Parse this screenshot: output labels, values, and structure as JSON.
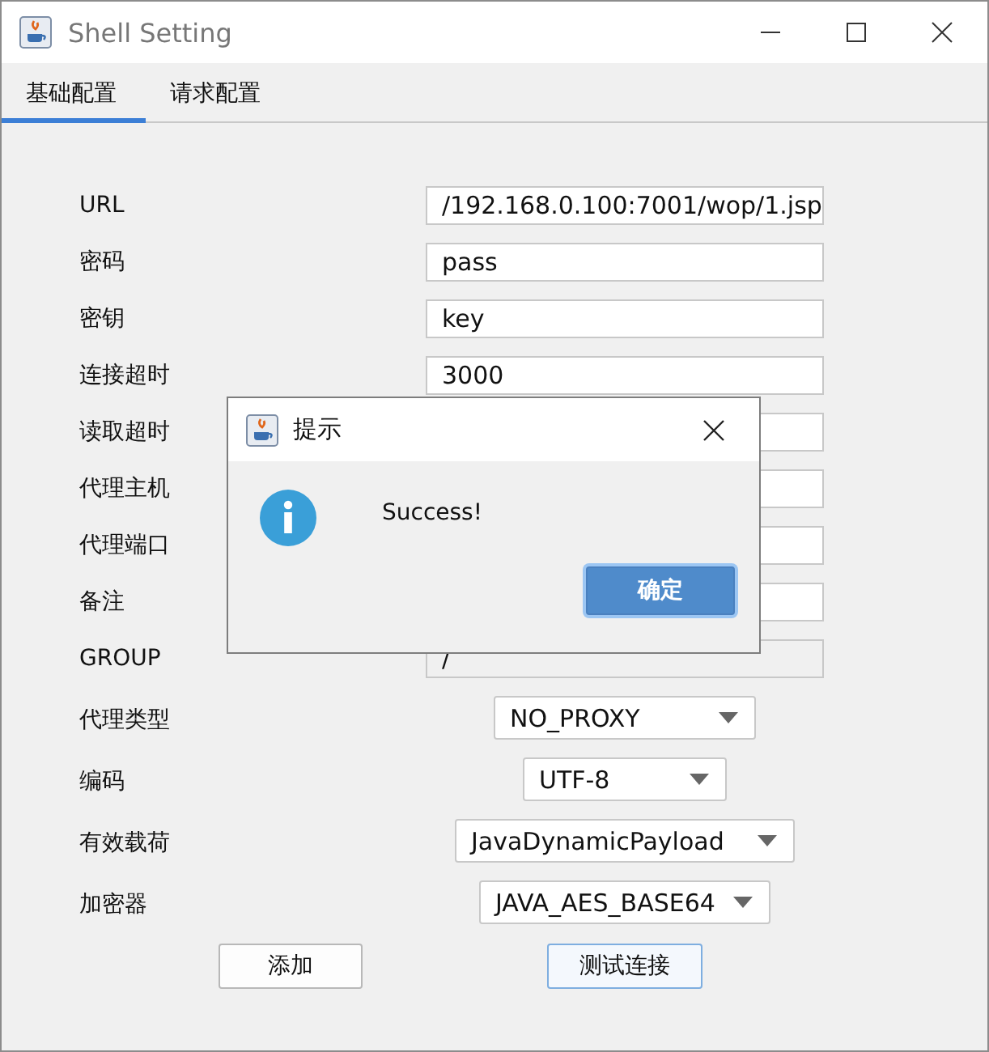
{
  "window": {
    "title": "Shell Setting"
  },
  "tabs": [
    {
      "label": "基础配置",
      "selected": true
    },
    {
      "label": "请求配置",
      "selected": false
    }
  ],
  "form": [
    {
      "kind": "field",
      "label": "URL",
      "value": "/192.168.0.100:7001/wop/1.jsp",
      "disabled": false
    },
    {
      "kind": "field",
      "label": "密码",
      "value": "pass",
      "disabled": false
    },
    {
      "kind": "field",
      "label": "密钥",
      "value": "key",
      "disabled": false
    },
    {
      "kind": "field",
      "label": "连接超时",
      "value": "3000",
      "disabled": false
    },
    {
      "kind": "field",
      "label": "读取超时",
      "disabled": false
    },
    {
      "kind": "field",
      "label": "代理主机",
      "disabled": false
    },
    {
      "kind": "field",
      "label": "代理端口",
      "disabled": false
    },
    {
      "kind": "field",
      "label": "备注",
      "disabled": false
    },
    {
      "kind": "field",
      "label": "GROUP",
      "value": "/",
      "disabled": true
    },
    {
      "kind": "select",
      "label": "代理类型",
      "value": "NO_PROXY"
    },
    {
      "kind": "select",
      "label": "编码",
      "value": "UTF-8"
    },
    {
      "kind": "select",
      "label": "有效载荷",
      "value": "JavaDynamicPayload"
    },
    {
      "kind": "select",
      "label": "加密器",
      "value": "JAVA_AES_BASE64"
    }
  ],
  "buttons": [
    {
      "label": "添加",
      "focused": false
    },
    {
      "label": "测试连接",
      "focused": true
    }
  ],
  "dialog": {
    "title": "提示",
    "message": "Success!",
    "button": "确定"
  }
}
